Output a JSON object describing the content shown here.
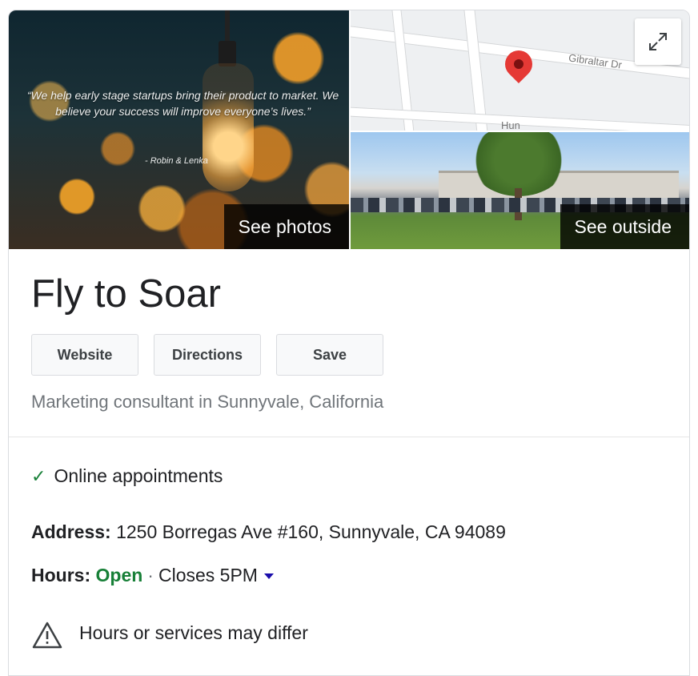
{
  "photos": {
    "quote": "“We help early stage startups bring their product to market. We believe your success will improve everyone’s lives.”",
    "author": "- Robin & Lenka",
    "see_photos_label": "See photos"
  },
  "map": {
    "street_label": "Gibraltar Dr",
    "street_label_partial": "Hun",
    "pin_color": "#e53935",
    "expand_icon": "expand-icon"
  },
  "street_view": {
    "see_outside_label": "See outside"
  },
  "business": {
    "name": "Fly to Soar",
    "buttons": {
      "website": "Website",
      "directions": "Directions",
      "save": "Save"
    },
    "category": "Marketing consultant in Sunnyvale, California",
    "online_appointments": "Online appointments",
    "address_label": "Address:",
    "address": "1250 Borregas Ave #160, Sunnyvale, CA 94089",
    "hours_label": "Hours:",
    "hours_status": "Open",
    "hours_separator": "·",
    "hours_closes": "Closes 5PM",
    "notice": "Hours or services may differ"
  },
  "colors": {
    "open_green": "#188038",
    "text_dark": "#202124",
    "text_muted": "#70757a"
  }
}
